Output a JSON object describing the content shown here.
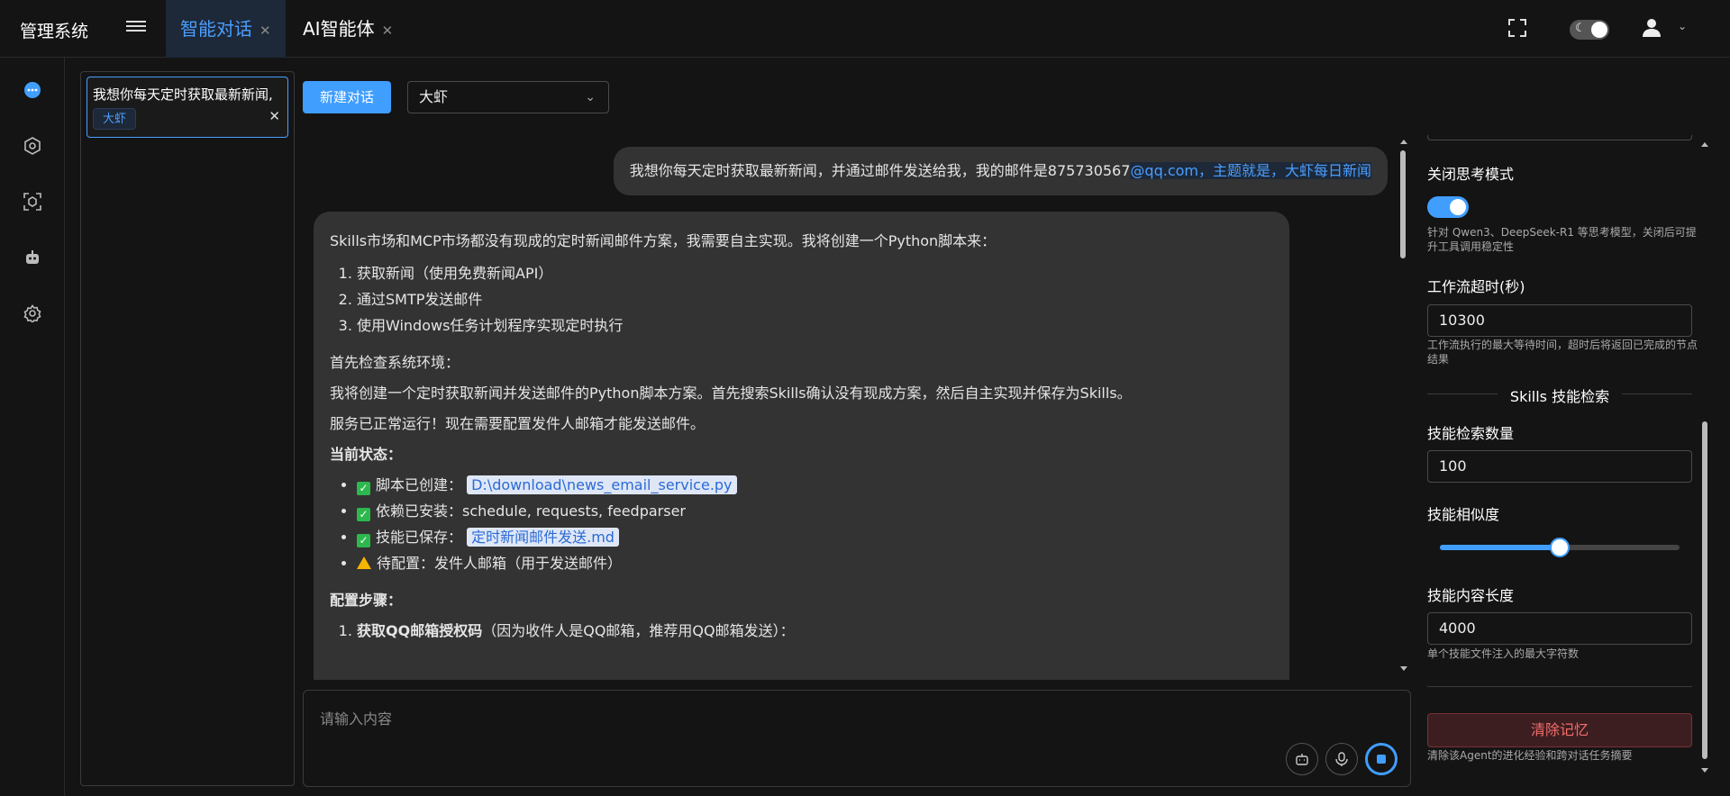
{
  "app": {
    "title": "管理系统",
    "tabs": [
      {
        "label": "智能对话",
        "active": true
      },
      {
        "label": "AI智能体",
        "active": false
      }
    ]
  },
  "icons": {
    "sidebar": [
      "chat-icon",
      "workflow-icon",
      "scan-icon",
      "robot-icon",
      "gear-icon"
    ],
    "top": [
      "fullscreen-icon",
      "theme-toggle-icon",
      "user-icon",
      "chevron-down-icon"
    ]
  },
  "colors": {
    "accent": "#409eff",
    "danger": "#f56c6c",
    "bg": "#141414",
    "bubble": "#333333"
  },
  "history": {
    "title": "我想你每天定时获取最新新闻,",
    "tag": "大虾"
  },
  "toolbar": {
    "new_chat": "新建对话",
    "agent": "大虾"
  },
  "chat": {
    "user_text": "我想你每天定时获取最新新闻，并通过邮件发送给我，我的邮件是875730567",
    "user_link": "@qq.com，主题就是，大虾每日新闻",
    "intro": "Skills市场和MCP市场都没有现成的定时新闻邮件方案，我需要自主实现。我将创建一个Python脚本来：",
    "steps": [
      "获取新闻（使用免费新闻API）",
      "通过SMTP发送邮件",
      "使用Windows任务计划程序实现定时执行"
    ],
    "line1": "首先检查系统环境：",
    "line2": "我将创建一个定时获取新闻并发送邮件的Python脚本方案。首先搜索Skills确认没有现成方案，然后自主实现并保存为Skills。",
    "line3": "服务已正常运行！现在需要配置发件人邮箱才能发送邮件。",
    "status_heading": "当前状态：",
    "status": {
      "script_label": "脚本已创建：",
      "script_path": "D:\\download\\news_email_service.py",
      "deps_label": "依赖已安装：",
      "deps_value": "schedule, requests, feedparser",
      "skill_label": "技能已保存：",
      "skill_file": "定时新闻邮件发送.md",
      "pending_label": "待配置：",
      "pending_value": "发件人邮箱（用于发送邮件）"
    },
    "config_heading": "配置步骤：",
    "config_step1_bold": "获取QQ邮箱授权码",
    "config_step1_rest": "（因为收件人是QQ邮箱，推荐用QQ邮箱发送）："
  },
  "input": {
    "placeholder": "请输入内容"
  },
  "settings": {
    "think_label": "关闭思考模式",
    "think_hint": "针对 Qwen3、DeepSeek-R1 等思考模型，关闭后可提升工具调用稳定性",
    "think_enabled": true,
    "timeout_label": "工作流超时(秒)",
    "timeout_value": "10300",
    "timeout_hint": "工作流执行的最大等待时间，超时后将返回已完成的节点结果",
    "section_title": "Skills 技能检索",
    "count_label": "技能检索数量",
    "count_value": "100",
    "similarity_label": "技能相似度",
    "similarity_fraction": 0.5,
    "length_label": "技能内容长度",
    "length_value": "4000",
    "length_hint": "单个技能文件注入的最大字符数",
    "clear_label": "清除记忆",
    "clear_hint": "清除该Agent的进化经验和跨对话任务摘要"
  }
}
